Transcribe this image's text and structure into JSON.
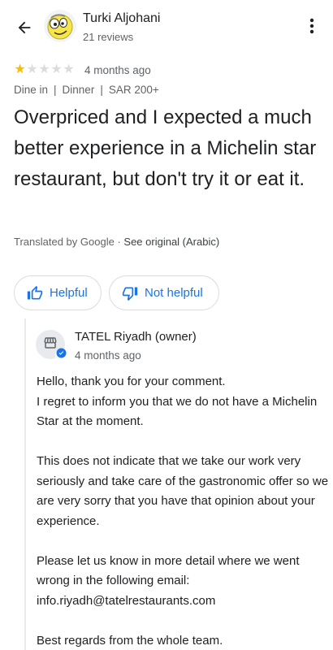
{
  "header": {
    "author_name": "Turki Aljohani",
    "author_reviews": "21 reviews",
    "back_icon": "arrow-back-icon",
    "more_icon": "more-vert-icon"
  },
  "review": {
    "rating": 1,
    "max_rating": 5,
    "time": "4 months ago",
    "meta": [
      "Dine in",
      "Dinner",
      "SAR 200+"
    ],
    "text": "Overpriced and I expected a much better experience in a Michelin star restaurant, but don't try it or eat it.",
    "translated_by": "Translated by Google",
    "translation_separator": "·",
    "see_original": "See original (Arabic)"
  },
  "actions": {
    "helpful_label": "Helpful",
    "not_helpful_label": "Not helpful"
  },
  "owner_reply": {
    "name": "TATEL Riyadh (owner)",
    "time": "4 months ago",
    "paragraphs": [
      [
        "Hello, thank you for your comment.",
        "I regret to inform you that we do not have a Michelin Star at the moment."
      ],
      [
        "This does not indicate that we take our work very seriously and take care of the gastronomic offer so we are very sorry that you have that opinion about your experience."
      ],
      [
        "Please let us know in more detail where we went wrong in the following email:",
        "info.riyadh@tatelrestaurants.com"
      ],
      [
        "Best regards from the whole team."
      ]
    ]
  },
  "colors": {
    "accent": "#1a73e8",
    "star_filled": "#fbbc04",
    "star_empty": "#dadce0",
    "text_primary": "#202124",
    "text_secondary": "#5f6368"
  }
}
